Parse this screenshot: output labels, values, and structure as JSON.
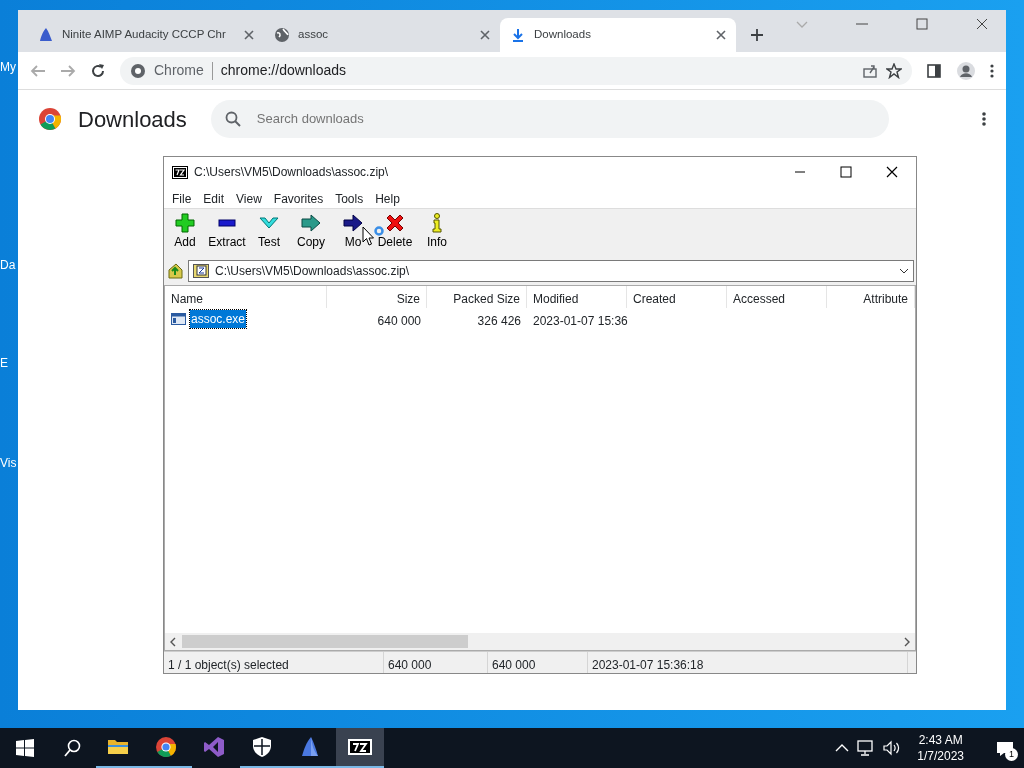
{
  "desktop_icons": [
    {
      "label": "My"
    },
    {
      "label": "Da"
    },
    {
      "label": "E"
    },
    {
      "label": "Vis"
    }
  ],
  "browser": {
    "tabs": [
      {
        "title": "Ninite AIMP Audacity CCCP Chr",
        "kind": "ninite",
        "selected": false
      },
      {
        "title": "assoc",
        "kind": "globe",
        "selected": false
      },
      {
        "title": "Downloads",
        "kind": "download",
        "selected": true
      }
    ],
    "origin": "Chrome",
    "url": "chrome://downloads",
    "page": {
      "title": "Downloads",
      "search_placeholder": "Search downloads"
    }
  },
  "archive_window": {
    "title": "C:\\Users\\VM5\\Downloads\\assoc.zip\\",
    "menu": [
      "File",
      "Edit",
      "View",
      "Favorites",
      "Tools",
      "Help"
    ],
    "toolbar": [
      {
        "label": "Add",
        "kind": "add"
      },
      {
        "label": "Extract",
        "kind": "extract"
      },
      {
        "label": "Test",
        "kind": "test"
      },
      {
        "label": "Copy",
        "kind": "copy"
      },
      {
        "label": "Mo",
        "kind": "move"
      },
      {
        "label": "Delete",
        "kind": "delete"
      },
      {
        "label": "Info",
        "kind": "info"
      }
    ],
    "path": "C:\\Users\\VM5\\Downloads\\assoc.zip\\",
    "columns": [
      "Name",
      "Size",
      "Packed Size",
      "Modified",
      "Created",
      "Accessed",
      "Attribute"
    ],
    "rows": [
      {
        "name": "assoc.exe",
        "size": "640 000",
        "packed_size": "326 426",
        "modified": "2023-01-07 15:36",
        "selected": true
      }
    ],
    "status": [
      "1 / 1 object(s) selected",
      "640 000",
      "640 000",
      "2023-01-07 15:36:18"
    ]
  },
  "taskbar": {
    "apps": [
      {
        "kind": "explorer",
        "running": true,
        "active": false
      },
      {
        "kind": "chrome",
        "running": true,
        "active": false
      },
      {
        "kind": "studio",
        "running": false,
        "active": false
      },
      {
        "kind": "shield",
        "running": true,
        "active": false
      },
      {
        "kind": "ninite",
        "running": true,
        "active": false
      },
      {
        "kind": "sevenzip",
        "running": true,
        "active": true
      }
    ],
    "time": "2:43 AM",
    "date": "1/7/2023",
    "notifications": "1"
  }
}
